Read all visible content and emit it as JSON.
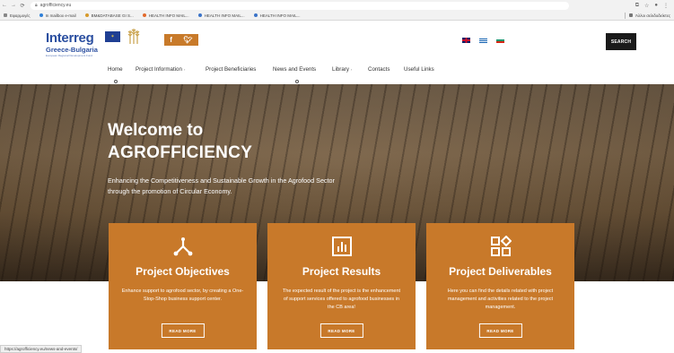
{
  "browser": {
    "url": "agrofficiency.eu",
    "bookmarks": [
      "Εφαρμογές",
      "In mailbox e-mail",
      "BM&DATABASE GI S...",
      "HEALTH INFO MAIL...",
      "HEALTH INFO MAIL...",
      "HEALTH INFO MAIL..."
    ],
    "other_bookmarks": "Άλλοι σελιδοδείκτες",
    "status_url": "https://agrofficiency.eu/news-and-events/"
  },
  "header": {
    "logo_word": "Interreg",
    "logo_region": "Greece-Bulgaria",
    "logo_tagline": "European Regional Development Fund",
    "social_icons": [
      "facebook-icon",
      "twitter-icon"
    ],
    "languages": [
      "english-flag",
      "greek-flag",
      "bulgarian-flag"
    ],
    "search_label": "SEARCH"
  },
  "nav": {
    "items": [
      {
        "label": "Home"
      },
      {
        "label": "Project Information",
        "has_submenu": true
      },
      {
        "label": "Project Beneficiaries"
      },
      {
        "label": "News and Events"
      },
      {
        "label": "Library",
        "has_submenu": true
      },
      {
        "label": "Contacts"
      },
      {
        "label": "Useful Links"
      }
    ]
  },
  "hero": {
    "title_line1": "Welcome to",
    "title_line2": "AGROFFICIENCY",
    "subtitle": "Enhancing the Competitiveness and Sustainable Growth in the Agrofood Sector through the promotion of Circular Economy."
  },
  "cards": [
    {
      "icon": "hierarchy-icon",
      "title": "Project Objectives",
      "description": "Enhance support to agrofood sector, by creating a One-Stop-Shop business support center.",
      "button": "READ MORE"
    },
    {
      "icon": "bar-chart-icon",
      "title": "Project Results",
      "description": "The expected result of the project is the enhancement of support services offered to agrofood businesses in the CB area!",
      "button": "READ MORE"
    },
    {
      "icon": "grid-diamond-icon",
      "title": "Project Deliverables",
      "description": "Here you can find the details related with project management and activities related to the project management.",
      "button": "READ MORE"
    }
  ],
  "colors": {
    "accent": "#c8792a",
    "brand_blue": "#2b4fa0",
    "search_bg": "#1a1a1a"
  }
}
